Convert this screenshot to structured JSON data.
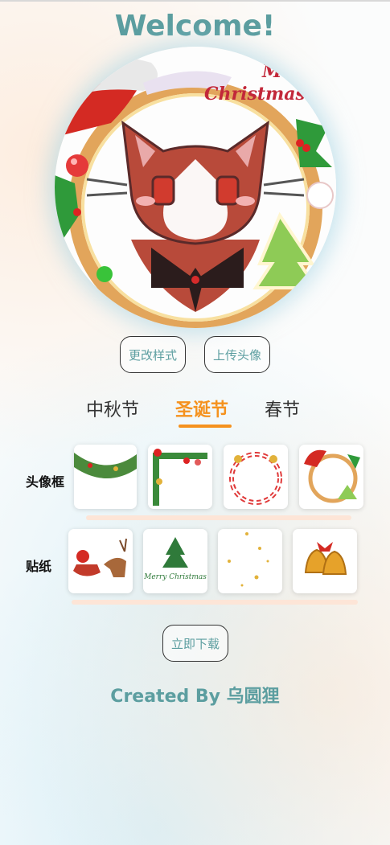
{
  "header": {
    "title": "Welcome!"
  },
  "avatar": {
    "badge_text": "Merry",
    "badge_text_2": "Christmas"
  },
  "buttons": {
    "change_style": "更改样式",
    "upload_avatar": "上传头像",
    "download": "立即下载"
  },
  "tabs": [
    {
      "label": "中秋节",
      "active": false
    },
    {
      "label": "圣诞节",
      "active": true
    },
    {
      "label": "春节",
      "active": false
    }
  ],
  "frames": {
    "label": "头像框",
    "items": [
      "pine-garland-frame",
      "corner-ornament-frame",
      "candy-cane-wreath-frame",
      "santa-hat-wreath-frame"
    ]
  },
  "stickers": {
    "label": "贴纸",
    "items": [
      "santa-sleigh-sticker",
      "christmas-tree-sticker",
      "sparkle-dots-sticker",
      "jingle-bells-sticker"
    ],
    "tree_caption": "Merry Christmas"
  },
  "footer": {
    "credit": "Created By 乌圆狸"
  },
  "colors": {
    "accent": "#5c9ea0",
    "active_tab": "#f5921e",
    "scrollbar": "#fde5d7"
  }
}
